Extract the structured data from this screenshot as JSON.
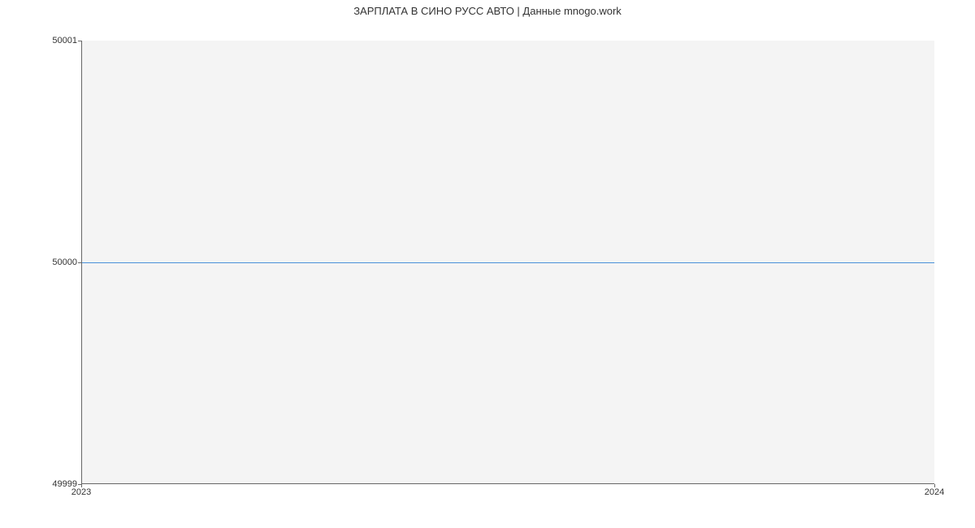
{
  "chart_data": {
    "type": "line",
    "title": "ЗАРПЛАТА В СИНО РУСС АВТО | Данные mnogo.work",
    "x": [
      2023,
      2024
    ],
    "values": [
      50000,
      50000
    ],
    "xlabel": "",
    "ylabel": "",
    "xlim": [
      2023,
      2024
    ],
    "ylim": [
      49999,
      50001
    ],
    "y_ticks": [
      49999,
      50000,
      50001
    ],
    "x_ticks": [
      2023,
      2024
    ],
    "line_color": "#4a90d9"
  }
}
